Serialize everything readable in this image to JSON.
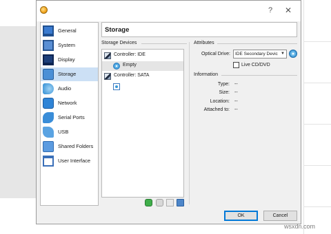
{
  "window": {
    "help_glyph": "?",
    "close_glyph": "✕"
  },
  "nav": {
    "items": [
      {
        "label": "General",
        "icon": "general-icon"
      },
      {
        "label": "System",
        "icon": "system-icon"
      },
      {
        "label": "Display",
        "icon": "display-icon"
      },
      {
        "label": "Storage",
        "icon": "storage-icon"
      },
      {
        "label": "Audio",
        "icon": "audio-icon"
      },
      {
        "label": "Network",
        "icon": "network-icon"
      },
      {
        "label": "Serial Ports",
        "icon": "serial-ports-icon"
      },
      {
        "label": "USB",
        "icon": "usb-icon"
      },
      {
        "label": "Shared Folders",
        "icon": "shared-folders-icon"
      },
      {
        "label": "User Interface",
        "icon": "user-interface-icon"
      }
    ],
    "selected": "Storage"
  },
  "header": {
    "title": "Storage"
  },
  "storage_devices": {
    "label": "Storage Devices",
    "tree": [
      {
        "label": "Controller: IDE",
        "type": "controller"
      },
      {
        "label": "Empty",
        "type": "optical-drive",
        "selected": true
      },
      {
        "label": "Controller: SATA",
        "type": "controller"
      },
      {
        "label": "",
        "type": "add-attachment"
      }
    ]
  },
  "attributes": {
    "label": "Attributes",
    "optical_drive_label": "Optical Drive:",
    "optical_drive_value": "IDE Secondary Devic",
    "live_cd_label": "Live CD/DVD",
    "live_cd_checked": false
  },
  "information": {
    "label": "Information",
    "rows": [
      {
        "key": "Type:",
        "value": "--"
      },
      {
        "key": "Size:",
        "value": "--"
      },
      {
        "key": "Location:",
        "value": "--"
      },
      {
        "key": "Attached to:",
        "value": "--"
      }
    ]
  },
  "buttons": {
    "ok": "OK",
    "cancel": "Cancel"
  },
  "watermark": "wsxdn.com",
  "colors": {
    "selection": "#cce0f5",
    "accent": "#0078d7"
  }
}
